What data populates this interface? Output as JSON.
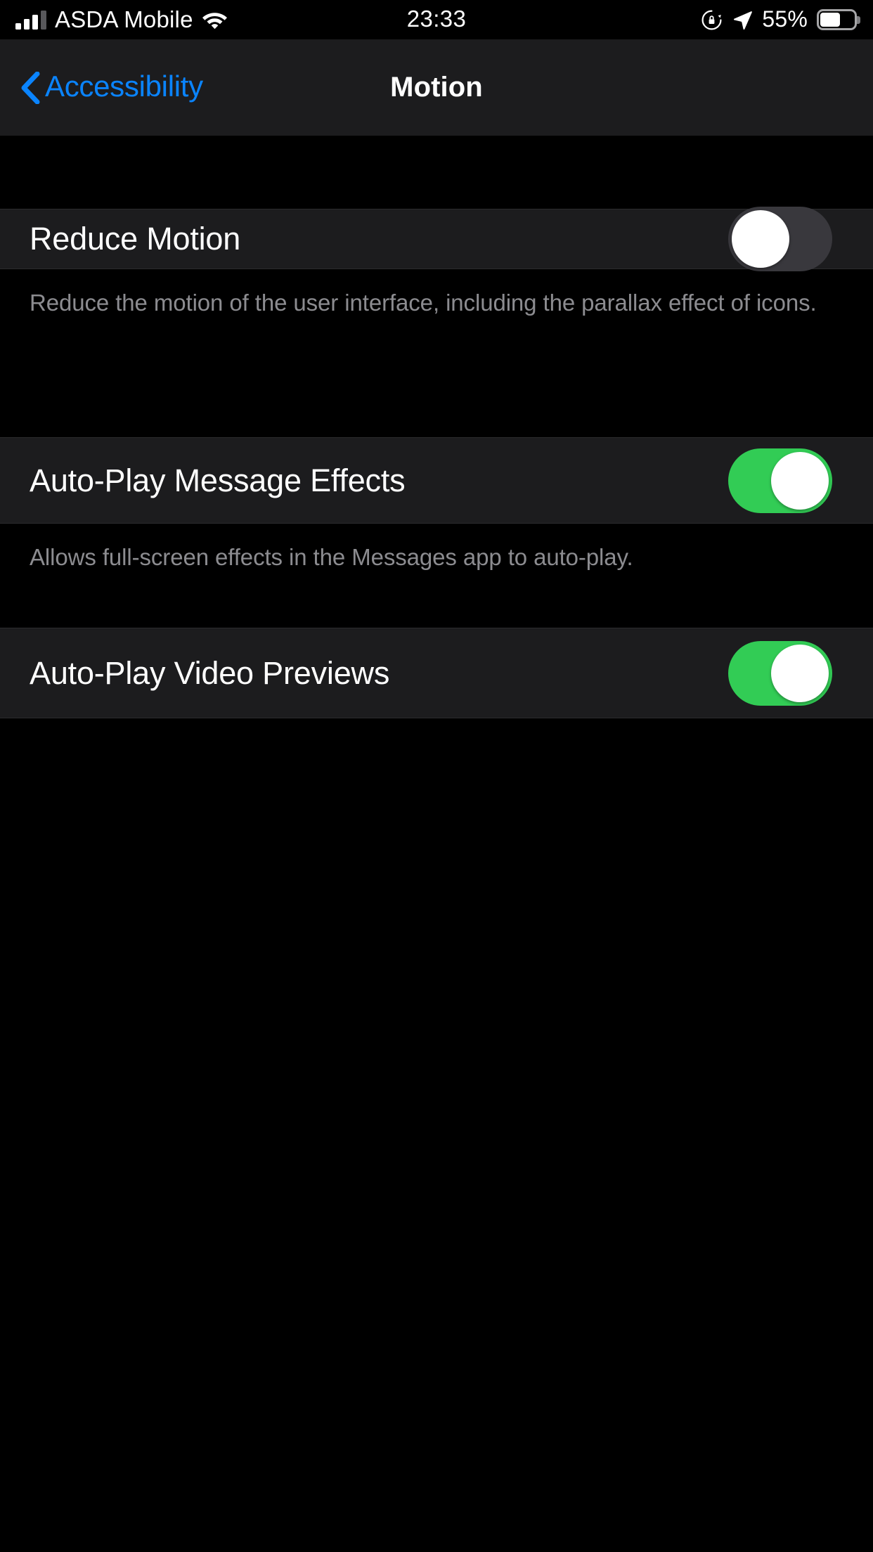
{
  "status_bar": {
    "carrier": "ASDA Mobile",
    "signal_bars_filled": 3,
    "signal_bars_total": 4,
    "wifi_icon": "wifi-icon",
    "time": "23:33",
    "rotation_lock_icon": "rotation-lock-icon",
    "location_icon": "location-arrow-icon",
    "battery_percent": "55%",
    "battery_level": 55,
    "battery_icon": "battery-icon"
  },
  "nav_bar": {
    "back_icon": "chevron-left-icon",
    "back_label": "Accessibility",
    "title": "Motion"
  },
  "sections": [
    {
      "row": {
        "label": "Reduce Motion",
        "toggle_state": "off"
      },
      "footer": "Reduce the motion of the user interface, including the parallax effect of icons."
    },
    {
      "row": {
        "label": "Auto-Play Message Effects",
        "toggle_state": "on"
      },
      "footer": "Allows full-screen effects in the Messages app to auto-play."
    },
    {
      "row": {
        "label": "Auto-Play Video Previews",
        "toggle_state": "on"
      },
      "footer": ""
    }
  ],
  "colors": {
    "background": "#000000",
    "cell_background": "#1c1c1e",
    "tint_blue": "#0a84ff",
    "toggle_on_green": "#32cc55",
    "toggle_off_gray": "#39383d",
    "footer_text": "#8c8c90",
    "primary_text": "#ffffff"
  }
}
